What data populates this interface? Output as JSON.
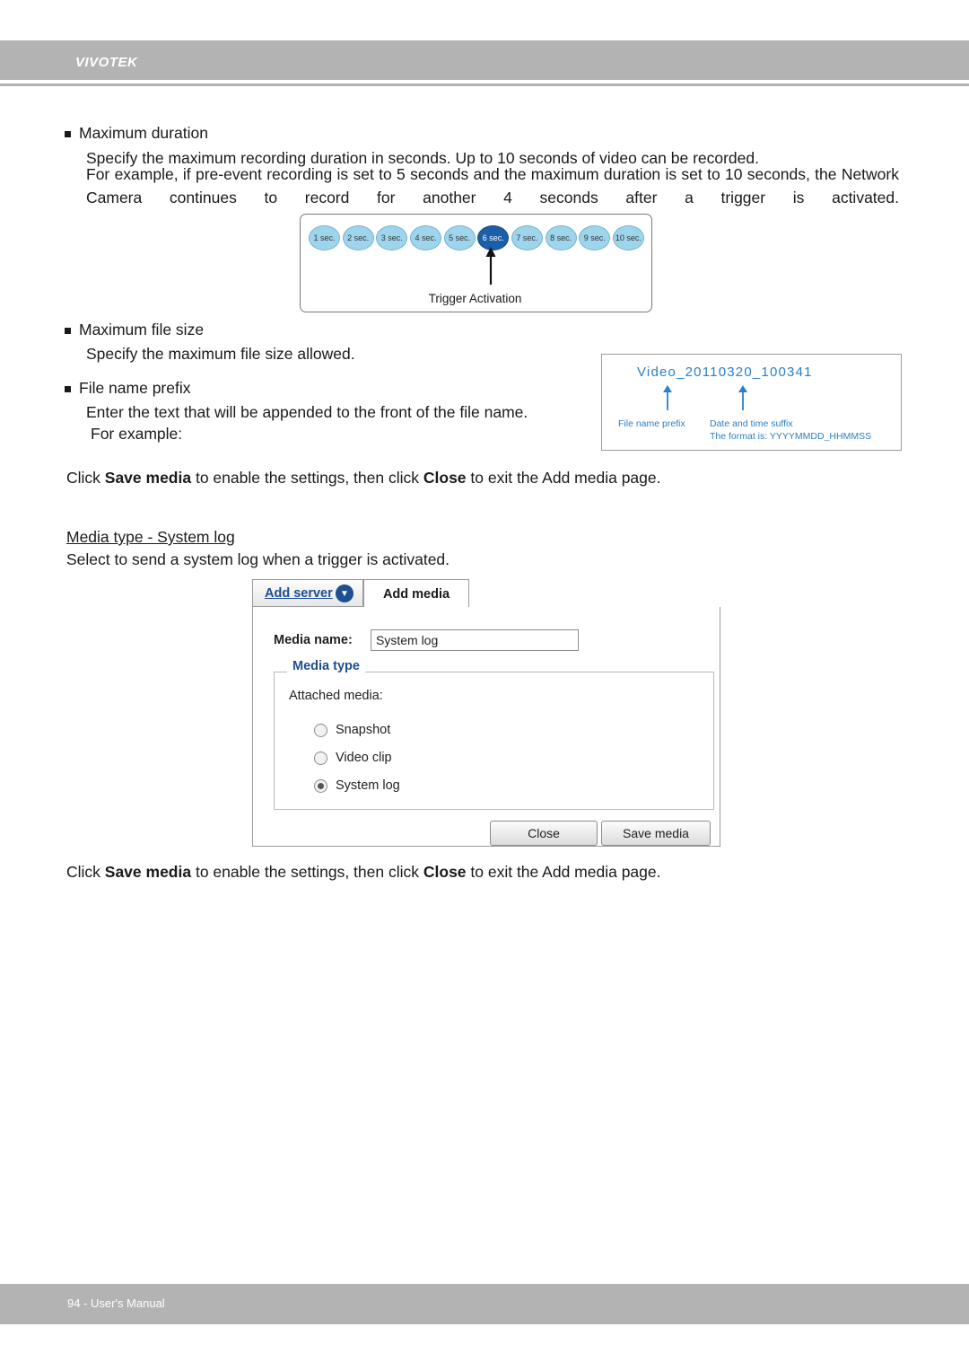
{
  "header": {
    "brand": "VIVOTEK"
  },
  "footer": {
    "text": "94 - User's Manual"
  },
  "content": {
    "bullet1_title": "Maximum duration",
    "bullet1_line1": "Specify the maximum recording duration in seconds. Up to 10 seconds of video can be recorded.",
    "bullet1_line2": "For example, if pre-event recording is set to 5 seconds and the maximum duration is set to 10 seconds, the Network Camera continues to record for another 4 seconds after a trigger is activated.",
    "bullet2_title": "Maximum file size",
    "bullet2_line1": "Specify the maximum file size allowed.",
    "bullet3_title": "File name prefix",
    "bullet3_line1": "Enter the text that will be appended to the front of the file name.",
    "bullet3_line2": "For example:",
    "click_save_1_pre": "Click ",
    "click_save_1_b1": "Save media",
    "click_save_1_mid": " to enable the settings, then click ",
    "click_save_1_b2": "Close",
    "click_save_1_post": " to exit the Add media page.",
    "section_heading": "Media type - System log",
    "section_line": "Select to send a system log when a trigger is activated.",
    "click_save_2_pre": "Click ",
    "click_save_2_b1": "Save media",
    "click_save_2_mid": " to enable the settings, then click ",
    "click_save_2_b2": "Close",
    "click_save_2_post": " to exit the Add media page."
  },
  "timeline_figure": {
    "seconds": [
      "1 sec.",
      "2 sec.",
      "3 sec.",
      "4 sec.",
      "5 sec.",
      "6 sec.",
      "7 sec.",
      "8 sec.",
      "9 sec.",
      "10 sec."
    ],
    "active_index": 5,
    "trigger_label": "Trigger Activation",
    "active_color": "#1b5fa8",
    "pill_color": "#9fd5ec"
  },
  "filename_figure": {
    "value": "Video_20110320_100341",
    "caption_left": "File name prefix",
    "caption_right": "Date and time suffix",
    "caption_format": "The format is: YYYYMMDD_HHMMSS",
    "accent_color": "#2a7fc9"
  },
  "dialog": {
    "tab_add_server": "Add server",
    "tab_add_server_badge": "▼",
    "tab_add_media": "Add media",
    "media_name_label": "Media name:",
    "media_name_value": "System log",
    "media_type_legend": "Media type",
    "attached_media_label": "Attached media:",
    "options": [
      {
        "label": "Snapshot",
        "checked": false
      },
      {
        "label": "Video clip",
        "checked": false
      },
      {
        "label": "System log",
        "checked": true
      }
    ],
    "close_button": "Close",
    "save_button": "Save media"
  }
}
